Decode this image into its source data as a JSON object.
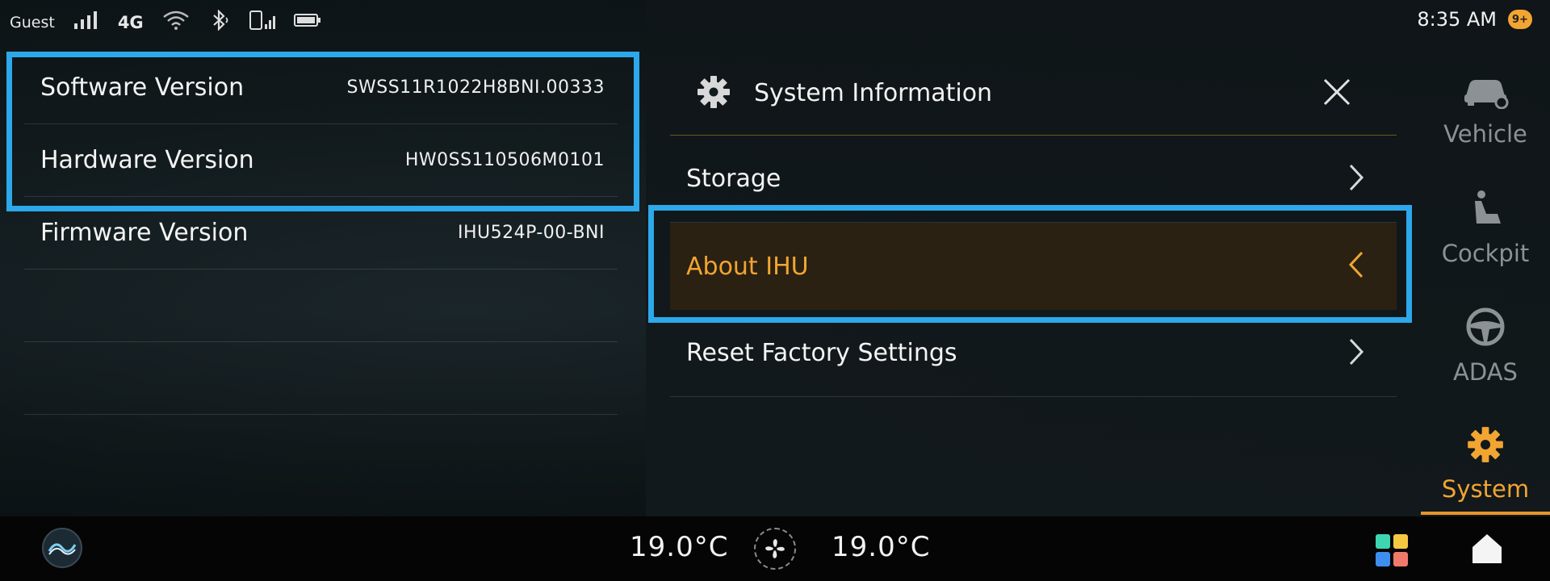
{
  "status_bar": {
    "user": "Guest",
    "network": "4G",
    "time": "8:35 AM",
    "notification_badge": "9+"
  },
  "about_details": {
    "rows": [
      {
        "label": "Software Version",
        "value": "SWSS11R1022H8BNI.00333"
      },
      {
        "label": "Hardware Version",
        "value": "HW0SS110506M0101"
      },
      {
        "label": "Firmware Version",
        "value": "IHU524P-00-BNI"
      }
    ]
  },
  "settings_panel": {
    "title": "System Information",
    "icon": "gear-icon",
    "items": [
      {
        "label": "Storage",
        "icon": "chevron-right-icon",
        "active": false
      },
      {
        "label": "About IHU",
        "icon": "chevron-left-icon",
        "active": true
      },
      {
        "label": "Reset Factory Settings",
        "icon": "chevron-right-icon",
        "active": false
      }
    ]
  },
  "nav": {
    "items": [
      {
        "label": "Vehicle",
        "icon": "vehicle-icon",
        "active": false
      },
      {
        "label": "Cockpit",
        "icon": "seat-icon",
        "active": false
      },
      {
        "label": "ADAS",
        "icon": "steering-wheel-icon",
        "active": false
      },
      {
        "label": "System",
        "icon": "gear-icon",
        "active": true
      }
    ]
  },
  "climate": {
    "left_temp": "19.0°C",
    "right_temp": "19.0°C"
  },
  "colors": {
    "accent": "#f2a531",
    "highlight_frame": "#2da8ea",
    "active_row_bg": "#2a2112",
    "inactive_nav": "#8c9195"
  }
}
